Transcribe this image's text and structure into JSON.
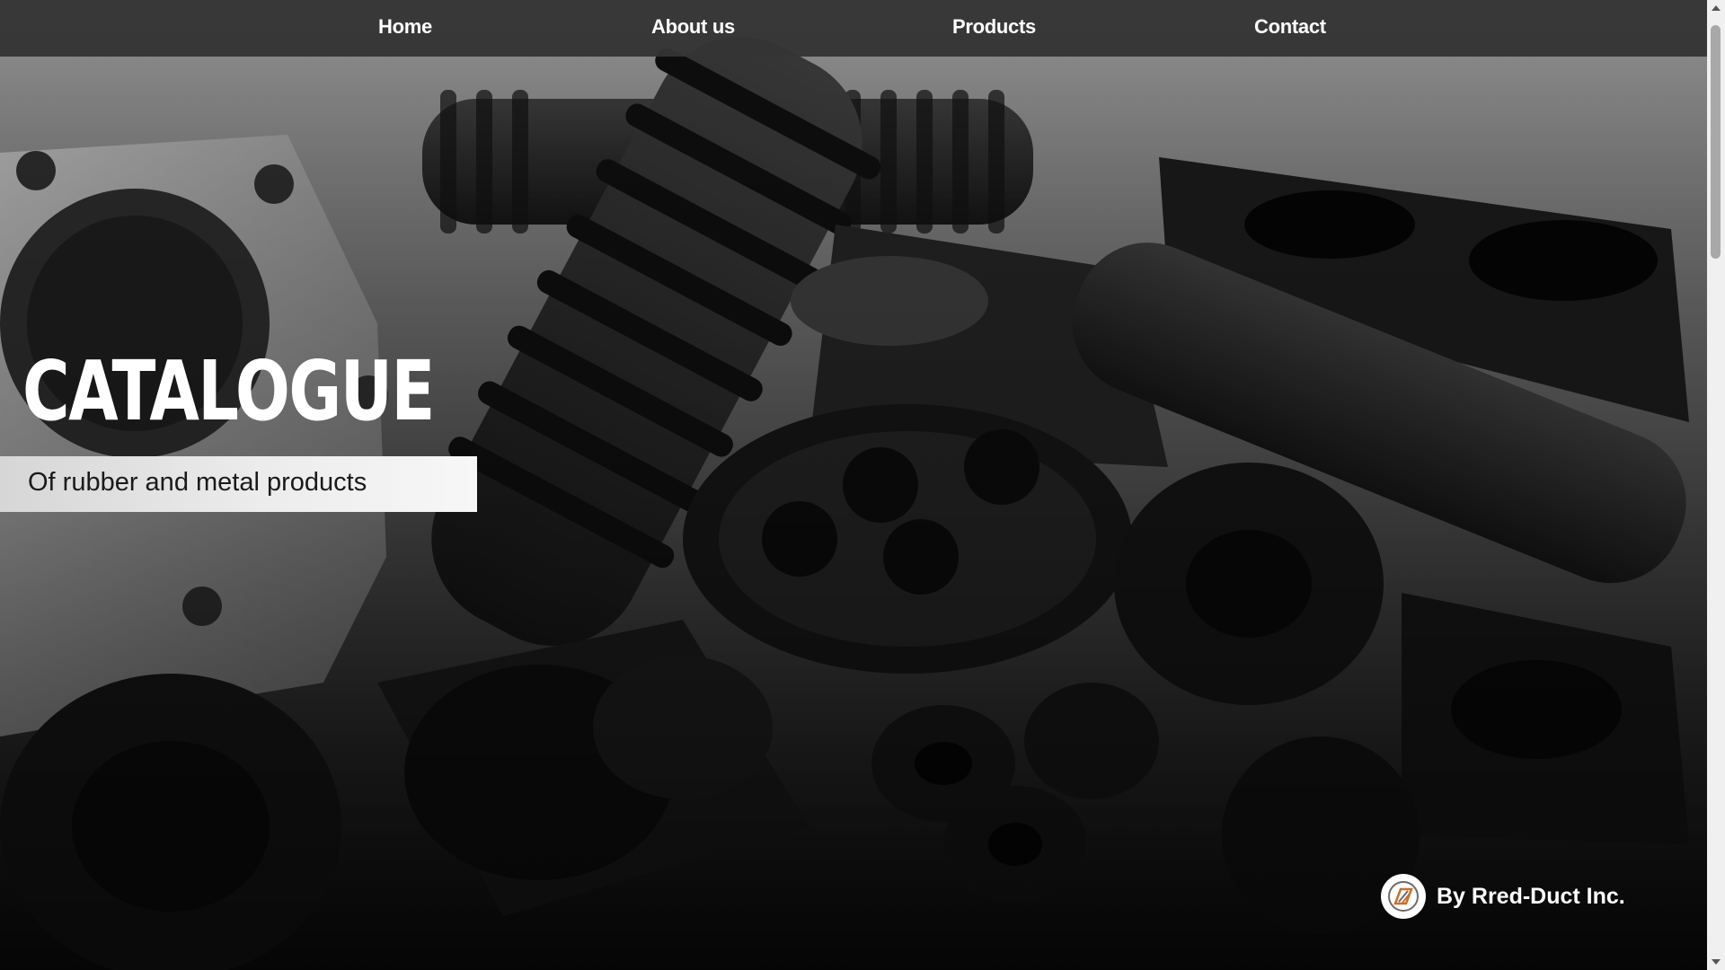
{
  "nav": {
    "home": "Home",
    "about": "About us",
    "products": "Products",
    "contact": "Contact"
  },
  "hero": {
    "title": "CATALOGUE",
    "subtitle": "Of rubber and metal products"
  },
  "brand": {
    "label": "By Rred-Duct Inc.",
    "logo_icon": "rred-duct-logo-icon",
    "logo_accent_color": "#c8702a"
  },
  "colors": {
    "nav_background": "#343434",
    "nav_text": "#ffffff",
    "subtitle_box": "#ececec",
    "subtitle_text": "#1a1a1a"
  }
}
